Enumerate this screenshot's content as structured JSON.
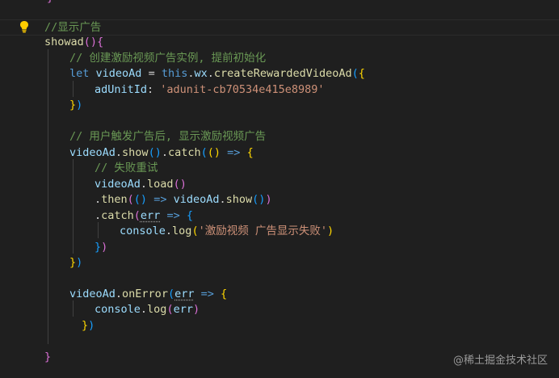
{
  "editor": {
    "theme_colors": {
      "background": "#1f1f1f",
      "keyword": "#569cd6",
      "function": "#dcdcaa",
      "variable": "#9cdcfe",
      "string": "#ce9178",
      "comment": "#6a9955",
      "bracket_1": "#ffd700",
      "bracket_2": "#da70d6",
      "bracket_3": "#179fff"
    },
    "lightbulb_icon": "lightbulb-icon",
    "code": {
      "top_brace": "}",
      "comment_show_ad": "//显示广告",
      "method_name": "showad",
      "comment_create": "// 创建激励视频广告实例, 提前初始化",
      "let_kw": "let",
      "video_ad_var": "videoAd",
      "equals": "=",
      "this_kw": "this",
      "wx_prop": "wx",
      "create_fn": "createRewardedVideoAd",
      "ad_unit_key": "adUnitId",
      "ad_unit_value": "'adunit-cb70534e415e8989'",
      "comment_trigger": "// 用户触发广告后, 显示激励视频广告",
      "show_fn": "show",
      "catch_fn": "catch",
      "arrow": "=>",
      "comment_fail_retry": "// 失败重试",
      "load_fn": "load",
      "then_fn": "then",
      "err_param": "err",
      "console_obj": "console",
      "log_fn": "log",
      "log_message": "'激励视频 广告显示失败'",
      "on_error_fn": "onError",
      "close_brace": "}"
    }
  },
  "watermark": "@稀土掘金技术社区"
}
